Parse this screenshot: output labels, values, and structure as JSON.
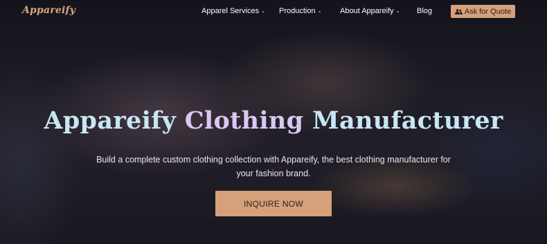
{
  "brand": {
    "logo_text": "Appareify",
    "logo_color": "#d8a77c"
  },
  "nav": {
    "items": [
      {
        "label": "Apparel Services",
        "has_dropdown": true,
        "icon": "chevron-down-icon"
      },
      {
        "label": "Production",
        "has_dropdown": true,
        "icon": "chevron-down-icon"
      },
      {
        "label": "About Appareify",
        "has_dropdown": true,
        "icon": "chevron-down-icon"
      },
      {
        "label": "Blog",
        "has_dropdown": false
      }
    ],
    "cta_label": "Ask for Quote",
    "cta_icon": "users-icon"
  },
  "hero": {
    "title_part1": "Appareify",
    "title_part2": "Clothing",
    "title_part3": "Manufacturer",
    "subtitle": "Build a complete custom clothing collection with Appareify, the best clothing manufacturer for your fashion brand.",
    "cta_label": "INQUIRE NOW"
  },
  "colors": {
    "accent": "#d6a07a",
    "headline": "#c8e6f4",
    "headline_accent": "#d9c8f2",
    "background": "#1a1a24"
  }
}
